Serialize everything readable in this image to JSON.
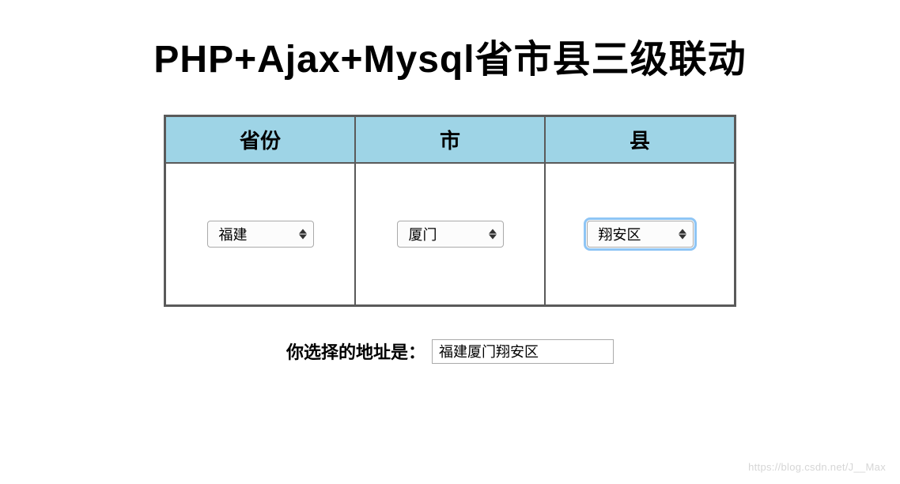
{
  "title": "PHP+Ajax+Mysql省市县三级联动",
  "table": {
    "headers": {
      "province": "省份",
      "city": "市",
      "county": "县"
    },
    "selects": {
      "province": {
        "value": "福建",
        "focused": false
      },
      "city": {
        "value": "厦门",
        "focused": false
      },
      "county": {
        "value": "翔安区",
        "focused": true
      }
    }
  },
  "result": {
    "label": "你选择的地址是：",
    "value": "福建厦门翔安区"
  },
  "watermark": "https://blog.csdn.net/J__Max"
}
